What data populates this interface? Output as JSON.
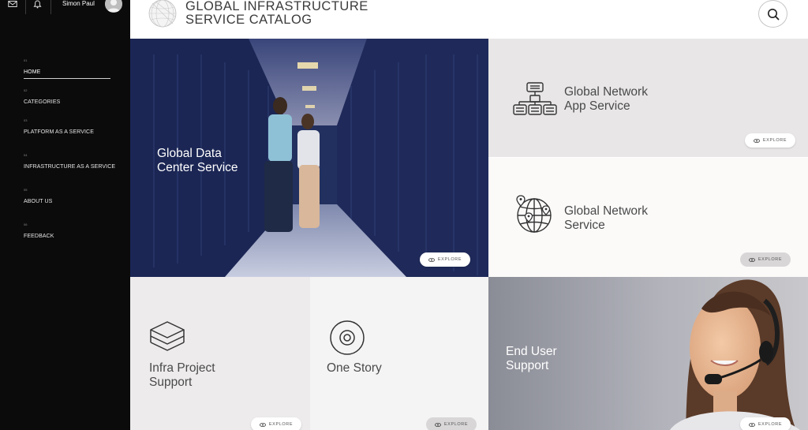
{
  "user": {
    "name": "Simon Paul"
  },
  "header": {
    "title_line1": "GLOBAL INFRASTRUCTURE",
    "title_line2": "SERVICE CATALOG"
  },
  "sidebar": {
    "items": [
      {
        "num": "01",
        "label": "HOME"
      },
      {
        "num": "02",
        "label": "CATEGORIES"
      },
      {
        "num": "03",
        "label": "PLATFORM AS A SERVICE"
      },
      {
        "num": "04",
        "label": "INFRASTRUCTURE AS A SERVICE"
      },
      {
        "num": "05",
        "label": "ABOUT US"
      },
      {
        "num": "06",
        "label": "FEEDBACK"
      }
    ]
  },
  "tiles": {
    "datacenter": {
      "title_line1": "Global Data",
      "title_line2": "Center Service",
      "explore": "EXPLORE"
    },
    "netapp": {
      "title_line1": "Global Network",
      "title_line2": "App Service",
      "explore": "EXPLORE"
    },
    "network": {
      "title_line1": "Global Network",
      "title_line2": "Service",
      "explore": "EXPLORE"
    },
    "infra": {
      "title_line1": "Infra Project",
      "title_line2": "Support",
      "explore": "EXPLORE"
    },
    "story": {
      "title_line1": "One Story",
      "explore": "EXPLORE"
    },
    "support": {
      "title_line1": "End User",
      "title_line2": "Support",
      "explore": "EXPLORE"
    }
  },
  "icons": {
    "mail": "mail-icon",
    "bell": "bell-icon",
    "avatar": "avatar",
    "search": "search-icon",
    "logo": "globe-logo-icon",
    "eye": "eye-icon"
  },
  "colors": {
    "sidebar_bg": "#0b0b0b",
    "header_text": "#3b3b3b"
  }
}
